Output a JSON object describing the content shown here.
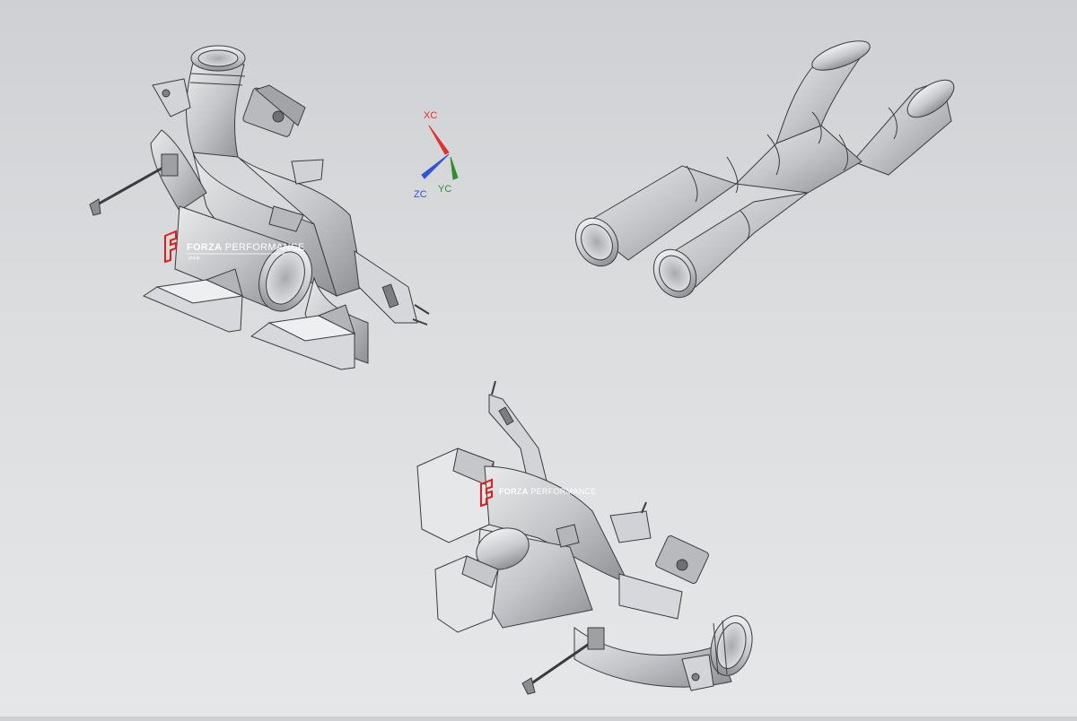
{
  "viewport": {
    "background_top": "#cfd0d3",
    "background_bottom": "#e6e7e9",
    "part_color": "#c9cacd",
    "part_shadow": "#8e8f93",
    "edge_color": "#3a3b3e"
  },
  "triad": {
    "x_label": "XC",
    "y_label": "YC",
    "z_label": "ZC",
    "x_color": "#e0312b",
    "y_color": "#2f8f2f",
    "z_color": "#2b56d6"
  },
  "watermarks": [
    {
      "brand_bold": "FORZA",
      "brand_light": " PERFORMANCE",
      "sub": "group",
      "logo_color": "#e11d1d"
    },
    {
      "brand_bold": "FORZA",
      "brand_light": " PERFORMANCE",
      "sub": "",
      "logo_color": "#e11d1d"
    }
  ]
}
